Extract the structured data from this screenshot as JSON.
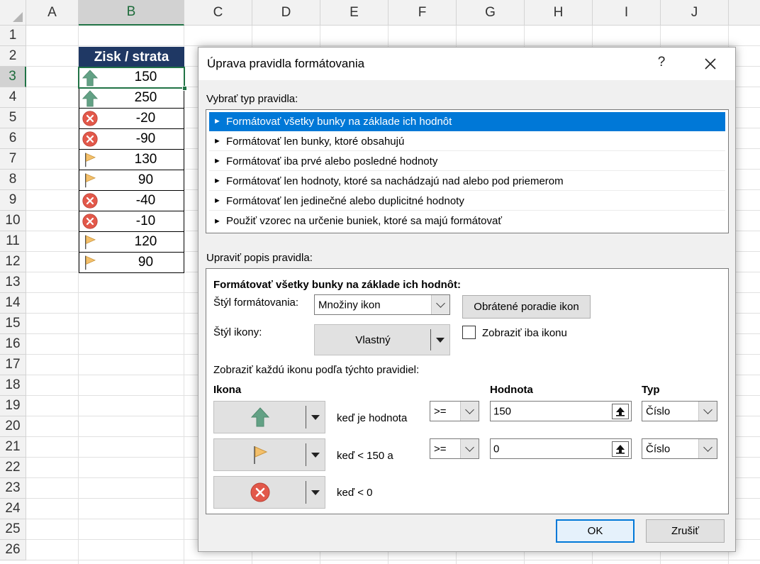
{
  "sheet": {
    "columns": [
      "A",
      "B",
      "C",
      "D",
      "E",
      "F",
      "G",
      "H",
      "I",
      "J"
    ],
    "rows": [
      "1",
      "2",
      "3",
      "4",
      "5",
      "6",
      "7",
      "8",
      "9",
      "10",
      "11",
      "12",
      "13",
      "14",
      "15",
      "16",
      "17",
      "18",
      "19",
      "20",
      "21",
      "22",
      "23",
      "24",
      "25",
      "26"
    ],
    "selected_column": "B",
    "selected_row": "3",
    "header_cell": "Zisk / strata",
    "data": [
      {
        "value": "150",
        "icon": "green-up-arrow-icon"
      },
      {
        "value": "250",
        "icon": "green-up-arrow-icon"
      },
      {
        "value": "-20",
        "icon": "red-x-circle-icon"
      },
      {
        "value": "-90",
        "icon": "red-x-circle-icon"
      },
      {
        "value": "130",
        "icon": "yellow-flag-icon"
      },
      {
        "value": "90",
        "icon": "yellow-flag-icon"
      },
      {
        "value": "-40",
        "icon": "red-x-circle-icon"
      },
      {
        "value": "-10",
        "icon": "red-x-circle-icon"
      },
      {
        "value": "120",
        "icon": "yellow-flag-icon"
      },
      {
        "value": "90",
        "icon": "yellow-flag-icon"
      }
    ],
    "colors": {
      "header_fill": "#1f3864",
      "selection": "#217346"
    }
  },
  "dialog": {
    "title": "Úprava pravidla formátovania",
    "help": "?",
    "select_rule_type_label": "Vybrať typ pravidla:",
    "rule_types": [
      "Formátovať všetky bunky na základe ich hodnôt",
      "Formátovať len bunky, ktoré obsahujú",
      "Formátovať iba prvé alebo posledné hodnoty",
      "Formátovať len hodnoty, ktoré sa nachádzajú nad alebo pod priemerom",
      "Formátovať len jedinečné alebo duplicitné hodnoty",
      "Použiť vzorec na určenie buniek, ktoré sa majú formátovať"
    ],
    "selected_rule_type": 0,
    "edit_description_label": "Upraviť popis pravidla:",
    "description_heading": "Formátovať všetky bunky na základe ich hodnôt:",
    "format_style_label": "Štýl formátovania:",
    "format_style_value": "Množiny ikon",
    "reverse_icon_order_button": "Obrátené poradie ikon",
    "icon_style_label": "Štýl ikony:",
    "icon_style_value": "Vlastný",
    "show_icon_only_label": "Zobraziť iba ikonu",
    "show_icon_only_checked": false,
    "rules_intro": "Zobraziť každú ikonu podľa týchto pravidiel:",
    "col_icon": "Ikona",
    "col_value": "Hodnota",
    "col_type": "Typ",
    "icon_rules": [
      {
        "icon": "green-up-arrow-icon",
        "condition": "keď je hodnota",
        "operator": ">=",
        "value": "150",
        "type": "Číslo"
      },
      {
        "icon": "yellow-flag-icon",
        "condition": "keď < 150 a",
        "operator": ">=",
        "value": "0",
        "type": "Číslo"
      },
      {
        "icon": "red-x-circle-icon",
        "condition": "keď < 0"
      }
    ],
    "ok_button": "OK",
    "cancel_button": "Zrušiť",
    "colors": {
      "selection": "#0078d7"
    }
  }
}
